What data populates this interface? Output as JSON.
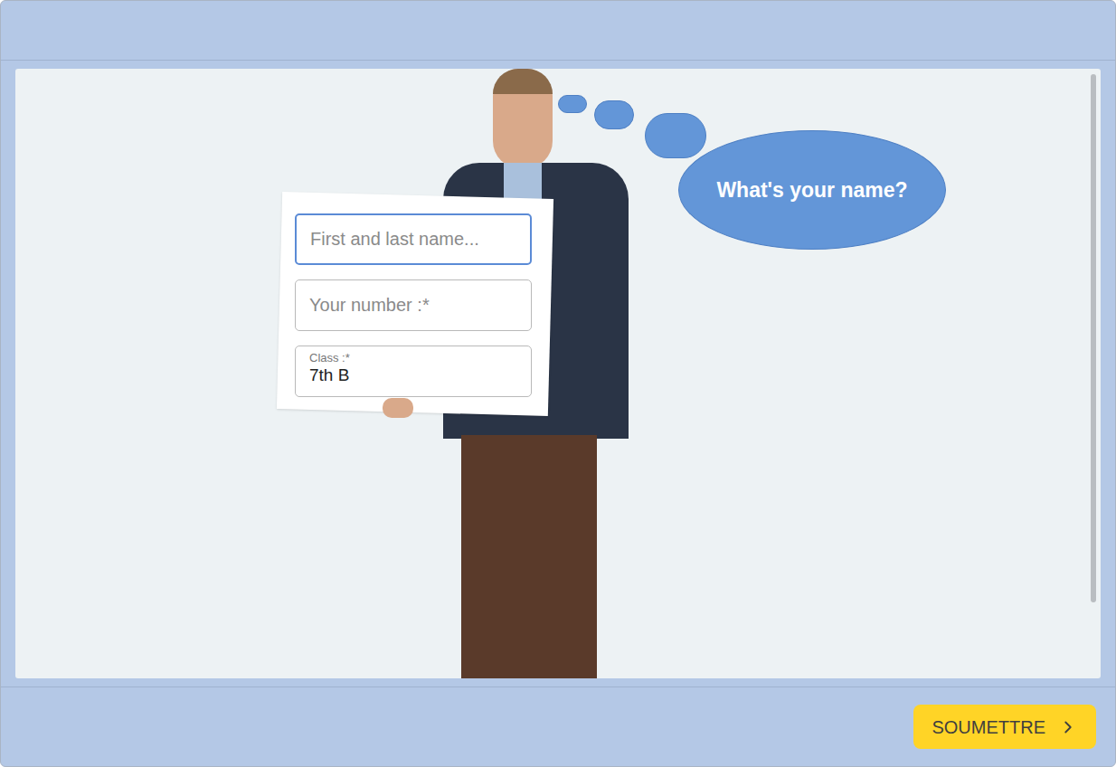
{
  "form": {
    "fields": [
      {
        "kind": "placeholder",
        "placeholder": "First and last name...",
        "focused": true
      },
      {
        "kind": "placeholder",
        "placeholder": "Your number :*",
        "focused": false
      },
      {
        "kind": "filled",
        "label": "Class :*",
        "value": "7th B",
        "focused": false
      }
    ]
  },
  "bubble": {
    "text": "What's your name?"
  },
  "buttons": [
    {
      "label": "SOUMETTRE"
    }
  ]
}
